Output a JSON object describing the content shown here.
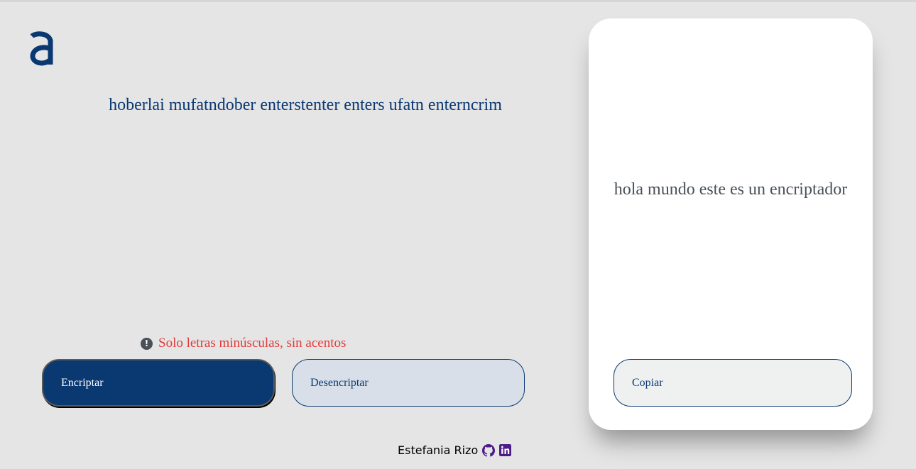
{
  "logo": {
    "icon": "alura-logo-icon",
    "color": "#0a3871"
  },
  "main": {
    "input_text": "hoberlai mufatndober enterstenter enters ufatn enterncrim",
    "hint": {
      "icon": "exclamation-circle-icon",
      "text": "Solo letras minúsculas, sin acentos"
    },
    "buttons": {
      "encrypt": "Encriptar",
      "decrypt": "Desencriptar"
    }
  },
  "output": {
    "text": "hola mundo este es un encriptador",
    "copy_label": "Copiar"
  },
  "footer": {
    "author": "Estefania Rizo",
    "icons": [
      "github-icon",
      "linkedin-icon"
    ]
  },
  "colors": {
    "primary": "#0a3871",
    "background": "#e5e5e5",
    "warning": "#e33a3a",
    "icon_accent": "#4b1c87"
  }
}
